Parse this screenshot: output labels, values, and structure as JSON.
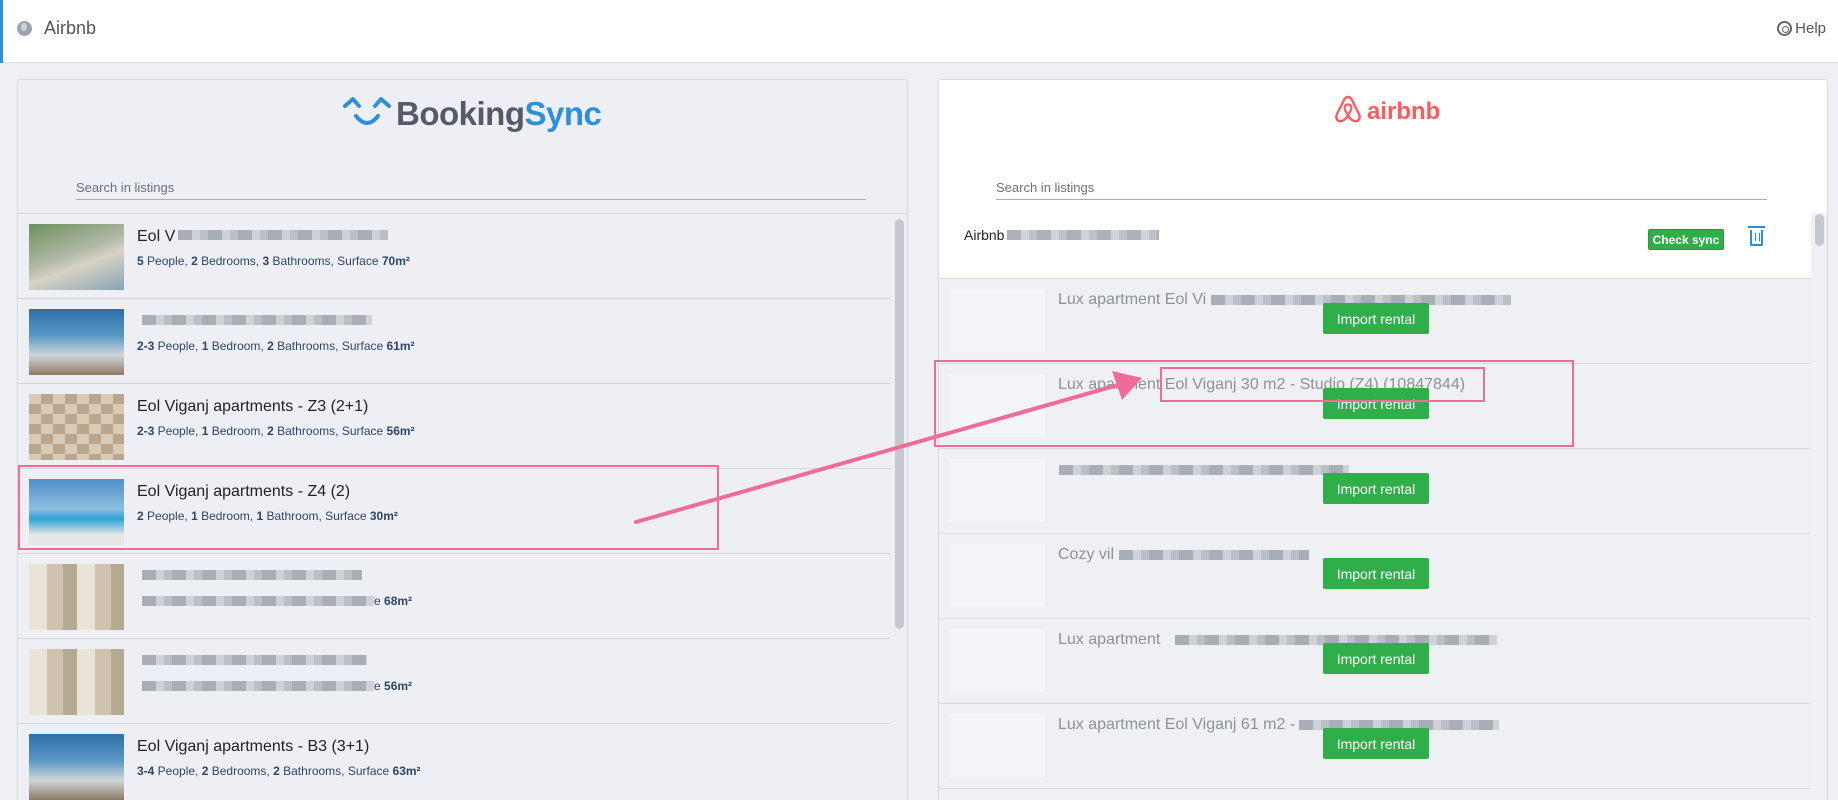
{
  "topbar": {
    "title": "Airbnb",
    "help": "Help"
  },
  "bookingsync": {
    "logo_booking": "Booking",
    "logo_sync": "Sync",
    "search_placeholder": "Search in listings",
    "listings": [
      {
        "name": "Eol V",
        "desc_people": "5",
        "desc_people_label": " People, ",
        "desc_bedrooms": "2",
        "desc_bedrooms_label": " Bedrooms, ",
        "desc_bathrooms": "3",
        "desc_bathrooms_label": " Bathrooms, Surface ",
        "desc_surface": "70m²"
      },
      {
        "name": "",
        "desc_people": "2-3",
        "desc_people_label": " People, ",
        "desc_bedrooms": "1",
        "desc_bedrooms_label": " Bedroom, ",
        "desc_bathrooms": "2",
        "desc_bathrooms_label": " Bathrooms, Surface ",
        "desc_surface": "61m²"
      },
      {
        "name": "Eol Viganj apartments - Z3 (2+1)",
        "desc_people": "2-3",
        "desc_people_label": " People, ",
        "desc_bedrooms": "1",
        "desc_bedrooms_label": " Bedroom, ",
        "desc_bathrooms": "2",
        "desc_bathrooms_label": " Bathrooms, Surface ",
        "desc_surface": "56m²"
      },
      {
        "name": "Eol Viganj apartments - Z4 (2)",
        "desc_people": "2",
        "desc_people_label": " People, ",
        "desc_bedrooms": "1",
        "desc_bedrooms_label": " Bedroom, ",
        "desc_bathrooms": "1",
        "desc_bathrooms_label": " Bathroom, Surface ",
        "desc_surface": "30m²"
      },
      {
        "name": "",
        "desc_people": "",
        "desc_people_label": "",
        "desc_bedrooms": "",
        "desc_bedrooms_label": "",
        "desc_bathrooms": "",
        "desc_bathrooms_label": "e ",
        "desc_surface": "68m²"
      },
      {
        "name": "",
        "desc_people": "",
        "desc_people_label": "",
        "desc_bedrooms": "",
        "desc_bedrooms_label": "",
        "desc_bathrooms": "",
        "desc_bathrooms_label": "e ",
        "desc_surface": "56m²"
      },
      {
        "name": "Eol Viganj apartments - B3 (3+1)",
        "desc_people": "3-4",
        "desc_people_label": " People, ",
        "desc_bedrooms": "2",
        "desc_bedrooms_label": " Bedrooms, ",
        "desc_bathrooms": "2",
        "desc_bathrooms_label": " Bathrooms, Surface ",
        "desc_surface": "63m²"
      }
    ]
  },
  "airbnb": {
    "logo": "airbnb",
    "search_placeholder": "Search in listings",
    "account_label": "Airbnb",
    "check_sync": "Check sync",
    "import_label": "Import rental",
    "listings": [
      {
        "name": "Lux apartment Eol Vi"
      },
      {
        "name": "Lux apartment Eol Viganj 30 m2 - Studio (Z4) (10847844)"
      },
      {
        "name": ""
      },
      {
        "name": "Cozy vil"
      },
      {
        "name": "Lux apartment"
      },
      {
        "name": "Lux apartment Eol Viganj 61 m2 -"
      }
    ]
  },
  "colors": {
    "accent_blue": "#2d8fd8",
    "button_green": "#2fae4a",
    "airbnb_red": "#ff5a5f",
    "annotation_pink": "#ef6b98"
  }
}
